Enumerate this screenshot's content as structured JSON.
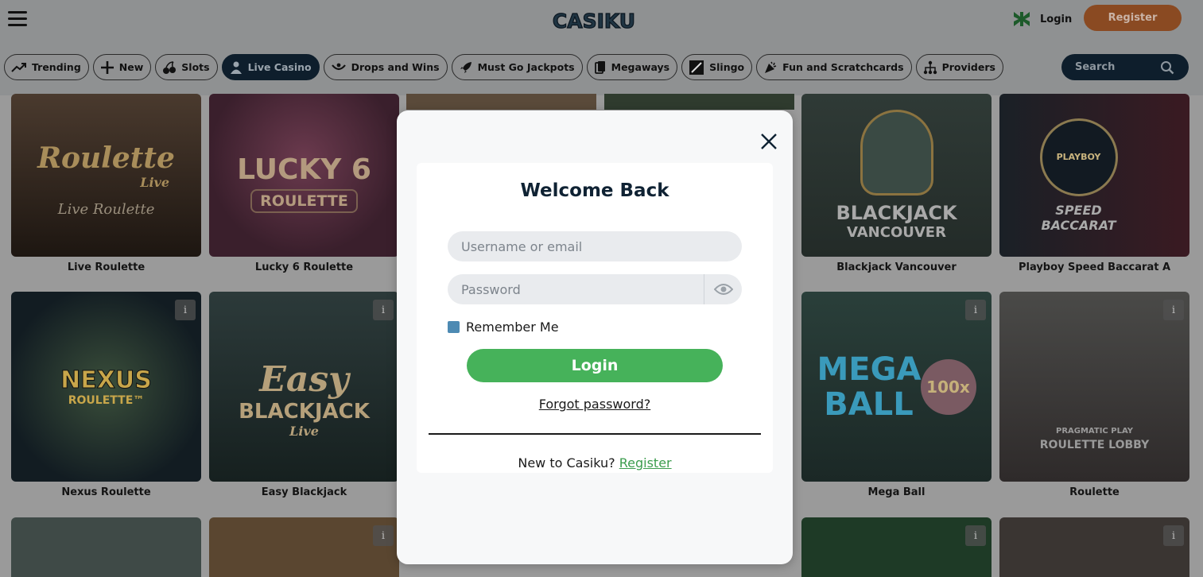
{
  "header": {
    "logo_text": "CASIKU",
    "login_label": "Login",
    "register_label": "Register"
  },
  "nav": {
    "items": [
      {
        "label": "Trending",
        "icon": "trending-icon"
      },
      {
        "label": "New",
        "icon": "plus-icon"
      },
      {
        "label": "Slots",
        "icon": "cherries-icon"
      },
      {
        "label": "Live Casino",
        "icon": "live-dealer-icon",
        "active": true
      },
      {
        "label": "Drops and Wins",
        "icon": "drops-icon"
      },
      {
        "label": "Must Go Jackpots",
        "icon": "rocket-icon"
      },
      {
        "label": "Megaways",
        "icon": "cards-icon"
      },
      {
        "label": "Slingo",
        "icon": "slingo-icon"
      },
      {
        "label": "Fun and Scratchcards",
        "icon": "party-icon"
      },
      {
        "label": "Providers",
        "icon": "providers-icon"
      }
    ],
    "search_label": "Search"
  },
  "games": {
    "row1": [
      "Live Roulette",
      "Lucky 6 Roulette",
      "",
      "",
      "Blackjack Vancouver",
      "Playboy Speed Baccarat A"
    ],
    "row2": [
      "Nexus Roulette",
      "Easy Blackjack",
      "",
      "",
      "Mega Ball",
      "Roulette"
    ],
    "art": {
      "live_roulette": "Roulette",
      "live_roulette_sub": "Live",
      "live_roulette_foot": "Live Roulette",
      "lucky6": "LUCKY 6",
      "lucky6_sub": "ROULETTE",
      "bj_vancouver": "BLACKJACK",
      "bj_vancouver_sub": "VANCOUVER",
      "playboy": "PLAYBOY",
      "playboy_sub": "SPEED BACCARAT",
      "nexus": "NEXUS",
      "nexus_sub": "ROULETTE™",
      "easy": "Easy",
      "easy_sub": "BLACKJACK",
      "easy_foot": "Live",
      "megaball": "MEGA BALL",
      "megaball_badge": "100x",
      "pragmatic": "PRAGMATIC PLAY",
      "pragmatic_sub": "ROULETTE LOBBY"
    }
  },
  "modal": {
    "title": "Welcome Back",
    "username_placeholder": "Username or email",
    "password_placeholder": "Password",
    "remember_label": "Remember Me",
    "login_label": "Login",
    "forgot_label": "Forgot password?",
    "new_to_text": "New to Casiku?",
    "register_link": "Register"
  },
  "colors": {
    "brand_navy": "#0e1e2c",
    "register_orange": "#c8642a",
    "login_green": "#46b25a",
    "link_green": "#3c9d4e",
    "checkbox_blue": "#4d8ab3"
  }
}
